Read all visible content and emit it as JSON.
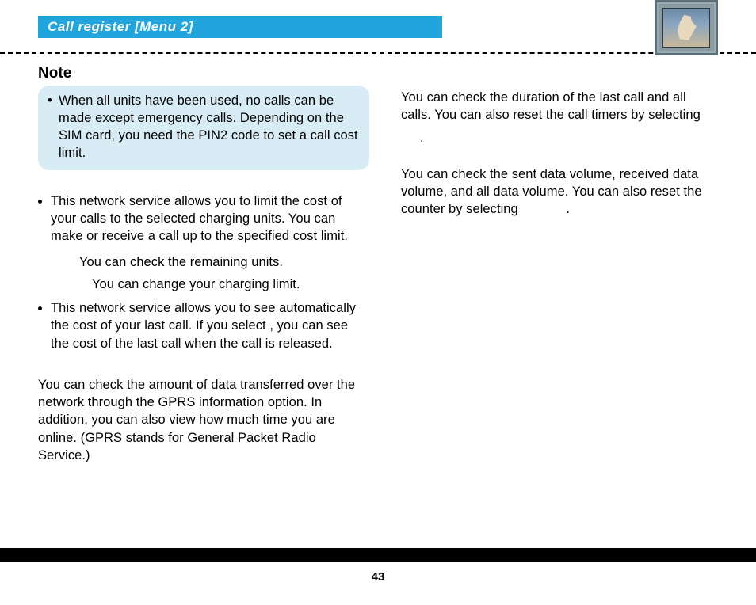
{
  "header": {
    "title": "Call register [Menu 2]"
  },
  "note": {
    "heading": "Note",
    "bullet": "•",
    "text": "When all units have been used, no calls can be made except emergency calls. Depending on the SIM card, you need the PIN2 code to set a call cost limit."
  },
  "left": {
    "item1": {
      "body": "This network service allows you to limit the cost of your calls to the selected charging units. You can make or receive a call up to the specified cost limit.",
      "sub_a": "You can check the remaining units.",
      "sub_b": "You can change your charging limit."
    },
    "item2": {
      "body_before": "This network service allows you to see automatically the cost of your last call. If you select ",
      "body_gap": "    ",
      "body_after": ", you can see the cost of the last call when the call is released."
    },
    "gprs": "You can check the amount of data transferred over the network through the GPRS information option. In addition, you can also view how much time you are online. (GPRS stands for General Packet Radio Service.)"
  },
  "right": {
    "p1_a": "You can check the duration of the last call and all calls. You can also reset the call timers by selecting ",
    "p1_b": ".",
    "p2_a": "You can check the sent data volume, received data volume, and all data volume. You can also reset the counter by selecting ",
    "p2_b": "."
  },
  "page_number": "43"
}
